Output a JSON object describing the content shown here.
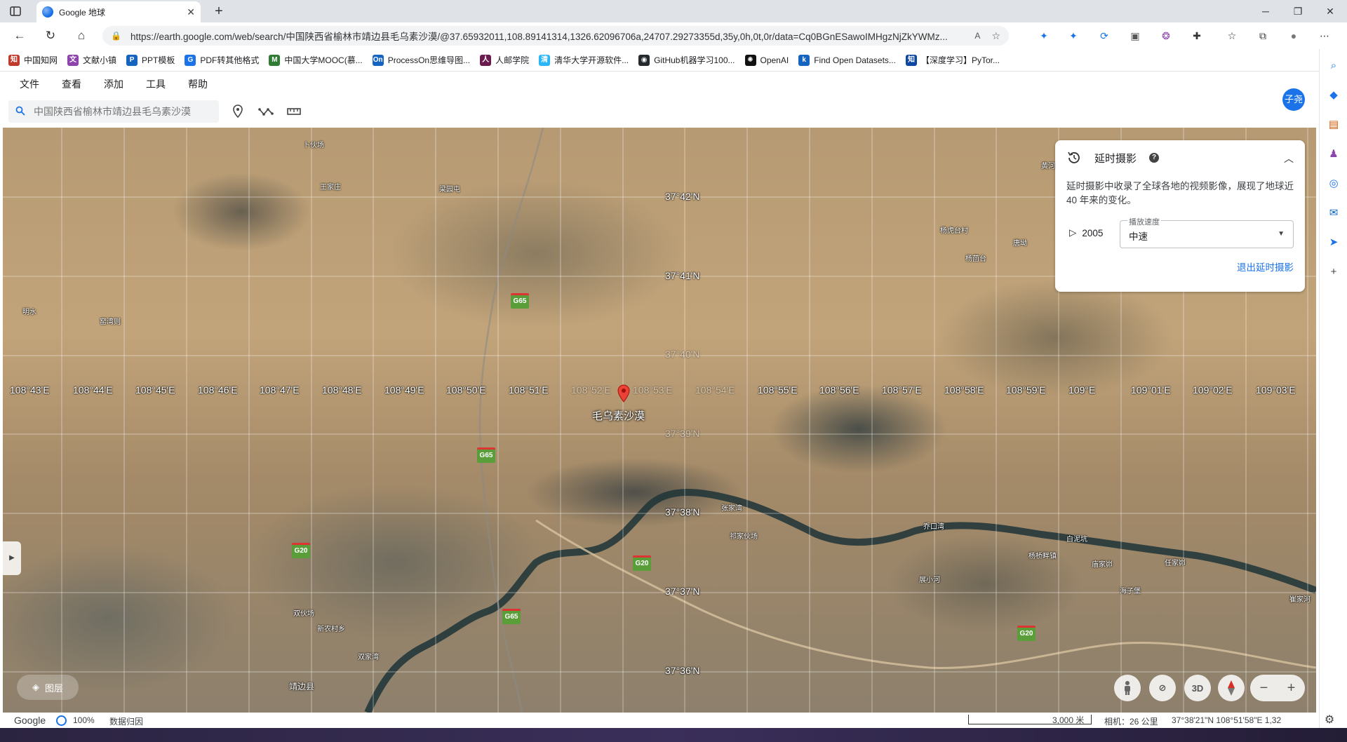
{
  "browser": {
    "tab_title": "Google 地球",
    "url": "https://earth.google.com/web/search/中国陕西省榆林市靖边县毛乌素沙漠/@37.65932011,108.89141314,1326.62096706a,24707.29273355d,35y,0h,0t,0r/data=Cq0BGnESawoIMHgzNjZkYWMz...",
    "bookmarks": [
      {
        "label": "中国知网",
        "color": "#c0392b"
      },
      {
        "label": "文献小镇",
        "color": "#8e44ad"
      },
      {
        "label": "PPT模板",
        "color": "#1565c0"
      },
      {
        "label": "PDF转其他格式",
        "color": "#1a73e8"
      },
      {
        "label": "中国大学MOOC(慕...",
        "color": "#2e7d32"
      },
      {
        "label": "ProcessOn思维导图...",
        "color": "#1565c0"
      },
      {
        "label": "人邮学院",
        "color": "#6a1b4d"
      },
      {
        "label": "清华大学开源软件...",
        "color": "#29b6f6"
      },
      {
        "label": "GitHub机器学习100...",
        "color": "#24292e"
      },
      {
        "label": "OpenAI",
        "color": "#111111"
      },
      {
        "label": "Find Open Datasets...",
        "color": "#1565c0"
      },
      {
        "label": "【深度学习】PyTor...",
        "color": "#0d47a1"
      }
    ]
  },
  "app": {
    "menu": [
      "文件",
      "查看",
      "添加",
      "工具",
      "帮助"
    ],
    "avatar_text": "子尧",
    "search_placeholder": "中国陕西省榆林市靖边县毛乌素沙漠"
  },
  "map": {
    "longitudes": [
      "108°43'E",
      "108°44'E",
      "108°45'E",
      "108°46'E",
      "108°47'E",
      "108°48'E",
      "108°49'E",
      "108°50'E",
      "108°51'E",
      "108°52'E",
      "108°53'E",
      "108°54'E",
      "108°55'E",
      "108°56'E",
      "108°57'E",
      "108°58'E",
      "108°59'E",
      "109°E",
      "109°01'E",
      "109°02'E",
      "109°03'E"
    ],
    "latitudes": [
      "37°42'N",
      "37°41'N",
      "37°40'N",
      "37°39'N",
      "37°38'N",
      "37°37'N",
      "37°36'N"
    ],
    "pin_label": "毛乌素沙漠",
    "places": [
      "卜伙场",
      "王家庄",
      "梁园屯",
      "明水",
      "窑湾则",
      "杨虎台村",
      "唐坳",
      "杨茴台",
      "张家湾",
      "祁家伙场",
      "乔口湾",
      "白泥坑",
      "杨桥畔镇",
      "庙家峁",
      "任家峁",
      "展小河",
      "海子堡",
      "双伙场",
      "新农村乡",
      "双家湾",
      "靖边县",
      "黄河湾",
      "崔家河"
    ],
    "highways": [
      "G65",
      "G65",
      "G20",
      "G20",
      "G65",
      "G20"
    ]
  },
  "timelapse": {
    "title": "延时摄影",
    "description": "延时摄影中收录了全球各地的视频影像，展现了地球近 40 年来的变化。",
    "year": "2005",
    "speed_label": "播放速度",
    "speed_value": "中速",
    "exit_label": "退出延时摄影"
  },
  "controls": {
    "layers_label": "图层",
    "three_d": "3D"
  },
  "status": {
    "logo": "Google",
    "percent": "100%",
    "attribution": "数据归因",
    "scale": "3,000 米",
    "camera": "相机：26 公里",
    "position": "37°38'21\"N 108°51'58\"E 1,32"
  }
}
